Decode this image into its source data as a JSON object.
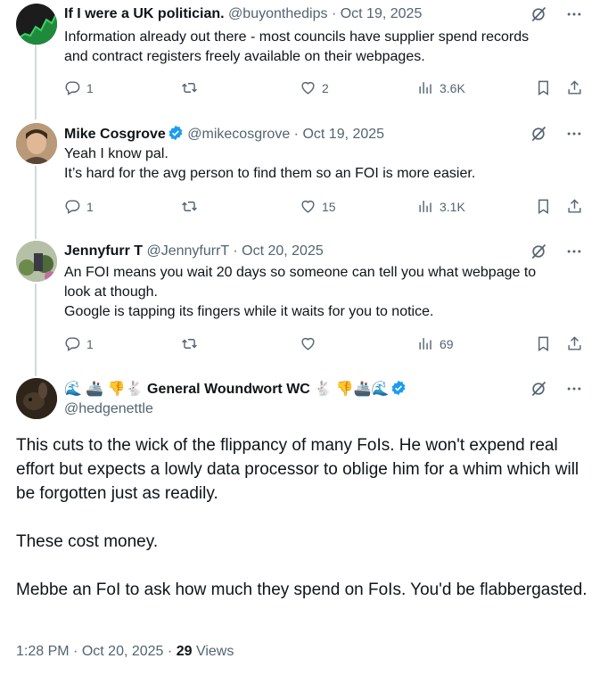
{
  "tweets": [
    {
      "display_name": "If I were a UK politician.",
      "handle": "@buyonthedips",
      "date": "Oct 19, 2025",
      "lines": [
        "Information already out there - most councils have supplier spend records",
        "and contract registers freely available on their webpages."
      ],
      "replies": "1",
      "retweets": "",
      "likes": "2",
      "views": "3.6K"
    },
    {
      "display_name": "Mike Cosgrove",
      "handle": "@mikecosgrove",
      "date": "Oct 19, 2025",
      "verified": true,
      "lines": [
        "Yeah I know pal.",
        "It’s hard for the avg person to find them so an FOI is more easier."
      ],
      "replies": "1",
      "retweets": "",
      "likes": "15",
      "views": "3.1K"
    },
    {
      "display_name": "Jennyfurr T",
      "handle": "@JennyfurrT",
      "date": "Oct 20, 2025",
      "lines": [
        "An FOI means you wait 20 days so someone can tell you what webpage to",
        "look at though.",
        "Google is tapping its fingers while it waits for you to notice."
      ],
      "replies": "1",
      "retweets": "",
      "likes": "",
      "views": "69"
    }
  ],
  "main_tweet": {
    "name_prefix_emoji": "🌊 🚢 👎🐇",
    "display_name": "General Woundwort WC",
    "name_suffix_emoji": "🐇 👎🚢🌊",
    "handle": "@hedgenettle",
    "paragraphs": [
      "This cuts to the wick of the flippancy of many FoIs.  He won't expend real effort but expects a lowly data processor to oblige him for a whim which will be forgotten just as readily.",
      "These cost money.",
      "Mebbe an FoI to ask how much they spend on FoIs.  You'd be flabbergasted."
    ],
    "time": "1:28 PM",
    "date": "Oct 20, 2025",
    "views_count": "29",
    "views_label": "Views"
  },
  "separator": "·",
  "colors": {
    "text": "#0f1419",
    "secondary": "#536471",
    "verified_blue": "#1d9bf0",
    "rail": "#cfd9de"
  },
  "icons": [
    "grok-icon",
    "more-icon",
    "reply-icon",
    "retweet-icon",
    "like-icon",
    "views-icon",
    "bookmark-icon",
    "share-icon",
    "verified-badge-icon"
  ]
}
